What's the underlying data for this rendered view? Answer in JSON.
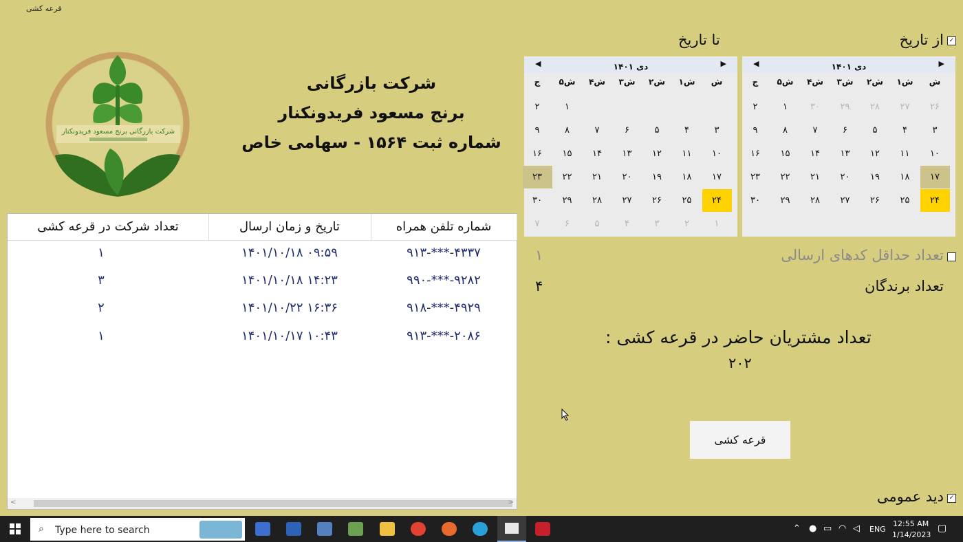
{
  "window": {
    "title": "قرعه کشی"
  },
  "filters": {
    "from_label": "از تاریخ",
    "to_label": "تا تاریخ",
    "min_codes_label": "تعداد حداقل کدهای ارسالی",
    "min_codes_value": "۱",
    "winners_label": "تعداد برندگان",
    "winners_value": "۴",
    "general_view_label": "دید عمومی"
  },
  "calendars": {
    "day_names": [
      "ش",
      "۱ش",
      "۲ش",
      "۳ش",
      "۴ش",
      "۵ش",
      "ج"
    ],
    "from": {
      "month_title": "دی ۱۴۰۱",
      "weeks": [
        [
          "۲۶",
          "۲۷",
          "۲۸",
          "۲۹",
          "۳۰",
          "۱",
          "۲"
        ],
        [
          "۳",
          "۴",
          "۵",
          "۶",
          "۷",
          "۸",
          "۹"
        ],
        [
          "۱۰",
          "۱۱",
          "۱۲",
          "۱۳",
          "۱۴",
          "۱۵",
          "۱۶"
        ],
        [
          "۱۷",
          "۱۸",
          "۱۹",
          "۲۰",
          "۲۱",
          "۲۲",
          "۲۳"
        ],
        [
          "۲۴",
          "۲۵",
          "۲۶",
          "۲۷",
          "۲۸",
          "۲۹",
          "۳۰"
        ]
      ]
    },
    "to": {
      "month_title": "دی ۱۴۰۱",
      "weeks": [
        [
          "",
          "",
          "",
          "",
          "",
          "۱",
          "۲"
        ],
        [
          "۳",
          "۴",
          "۵",
          "۶",
          "۷",
          "۸",
          "۹"
        ],
        [
          "۱۰",
          "۱۱",
          "۱۲",
          "۱۳",
          "۱۴",
          "۱۵",
          "۱۶"
        ],
        [
          "۱۷",
          "۱۸",
          "۱۹",
          "۲۰",
          "۲۱",
          "۲۲",
          "۲۳"
        ],
        [
          "۲۴",
          "۲۵",
          "۲۶",
          "۲۷",
          "۲۸",
          "۲۹",
          "۳۰"
        ],
        [
          "۱",
          "۲",
          "۳",
          "۴",
          "۵",
          "۶",
          "۷"
        ]
      ]
    }
  },
  "company": {
    "line1": "شرکت بازرگانی",
    "line2": "برنج مسعود فریدونکنار",
    "line3": "شماره ثبت ۱۵۶۴ - سهامی خاص"
  },
  "logo": {
    "text": "شرکت بازرگانی برنج مسعود فریدونکنار"
  },
  "table": {
    "columns": [
      "شماره تلفن همراه",
      "تاریخ و زمان ارسال",
      "تعداد شرکت در قرعه کشی"
    ],
    "rows": [
      [
        "۹۱۳-***-۴۳۳۷",
        "۱۴۰۱/۱۰/۱۸  ۰۹:۵۹",
        "۱"
      ],
      [
        "۹۹۰-***-۹۲۸۲",
        "۱۴۰۱/۱۰/۱۸  ۱۴:۲۳",
        "۳"
      ],
      [
        "۹۱۸-***-۴۹۲۹",
        "۱۴۰۱/۱۰/۲۲  ۱۶:۳۶",
        "۲"
      ],
      [
        "۹۱۳-***-۲۰۸۶",
        "۱۴۰۱/۱۰/۱۷  ۱۰:۴۳",
        "۱"
      ]
    ]
  },
  "summary": {
    "customers_label": "تعداد مشتریان حاضر در قرعه کشی :",
    "customers_value": "۲۰۲"
  },
  "draw_button": "قرعه کشی",
  "taskbar": {
    "search_placeholder": "Type here to search",
    "lang": "ENG",
    "time": "12:55 AM",
    "date": "1/14/2023"
  }
}
